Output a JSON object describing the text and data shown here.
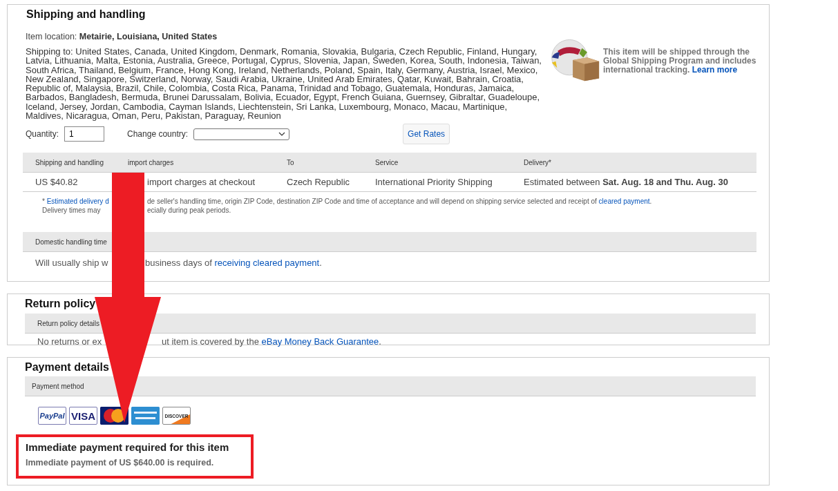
{
  "shipping": {
    "title": "Shipping and handling",
    "location_label": "Item location:",
    "location": "Metairie, Louisiana, United States",
    "ships_to": "Shipping to: United States, Canada, United Kingdom, Denmark, Romania, Slovakia, Bulgaria, Czech Republic, Finland, Hungary, Latvia, Lithuania, Malta, Estonia, Australia, Greece, Portugal, Cyprus, Slovenia, Japan, Sweden, Korea, South, Indonesia, Taiwan, South Africa, Thailand, Belgium, France, Hong Kong, Ireland, Netherlands, Poland, Spain, Italy, Germany, Austria, Israel, Mexico, New Zealand, Singapore, Switzerland, Norway, Saudi Arabia, Ukraine, United Arab Emirates, Qatar, Kuwait, Bahrain, Croatia, Republic of, Malaysia, Brazil, Chile, Colombia, Costa Rica, Panama, Trinidad and Tobago, Guatemala, Honduras, Jamaica, Barbados, Bangladesh, Bermuda, Brunei Darussalam, Bolivia, Ecuador, Egypt, French Guiana, Guernsey, Gibraltar, Guadeloupe, Iceland, Jersey, Jordan, Cambodia, Cayman Islands, Liechtenstein, Sri Lanka, Luxembourg, Monaco, Macau, Martinique, Maldives, Nicaragua, Oman, Peru, Pakistan, Paraguay, Reunion",
    "gsp": {
      "text": "This item will be shipped through the Global Shipping Program and includes international tracking.",
      "link": "Learn more"
    },
    "quantity": {
      "label": "Quantity:",
      "value": "1"
    },
    "country": {
      "label": "Change country:"
    },
    "get_rates": "Get Rates",
    "table": {
      "columns": [
        "Shipping and handling",
        "import charges",
        "To",
        "Service",
        "Delivery*"
      ],
      "row": [
        "US $40.82",
        "import charges at checkout",
        "Czech Republic",
        "International Priority Shipping",
        "Estimated between **Sat. Aug. 18 and Thu. Aug. 30**"
      ]
    },
    "footnote": [
      {
        "left": [
          {
            "text": "* "
          },
          {
            "text": "Estimated delivery d",
            "kind": "link"
          }
        ],
        "right": [
          {
            "text": "de seller's handling time, origin ZIP Code, destination ZIP Code and time of acceptance and will depend on shipping service selected and receipt of "
          },
          {
            "text": "cleared payment",
            "kind": "link"
          },
          {
            "text": "."
          }
        ]
      },
      {
        "left": [
          {
            "text": "Delivery times may"
          }
        ],
        "right": [
          {
            "text": "ecially during peak periods."
          }
        ]
      }
    ],
    "handling": {
      "header": "Domestic handling time",
      "left": [
        {
          "text": "Will usually ship w"
        }
      ],
      "right": [
        {
          "text": "business days of "
        },
        {
          "text": "receiving cleared payment",
          "kind": "link"
        },
        {
          "text": "."
        }
      ]
    }
  },
  "returns": {
    "title": "Return policy",
    "header": "Return policy details",
    "left": [
      {
        "text": "No returns or ex"
      }
    ],
    "right": [
      {
        "text": "ut item is covered by the "
      },
      {
        "text": "eBay Money Back Guarantee",
        "kind": "link"
      },
      {
        "text": "."
      }
    ]
  },
  "payment": {
    "title": "Payment details",
    "header": "Payment method",
    "cards": [
      {
        "kind": "paypal",
        "label": "PayPal"
      },
      {
        "kind": "visa",
        "label": "VISA"
      },
      {
        "kind": "mastercard"
      },
      {
        "kind": "amex"
      },
      {
        "kind": "discover",
        "label": "DISCOVER"
      }
    ],
    "notice": {
      "title": "Immediate payment required for this item",
      "text": "Immediate payment of US $640.00 is required."
    }
  }
}
